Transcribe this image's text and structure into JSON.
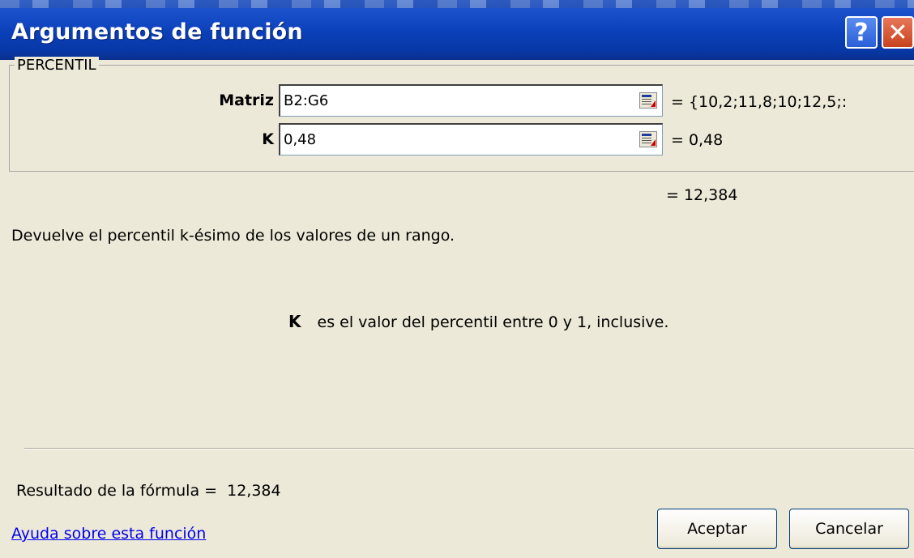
{
  "window": {
    "title": "Argumentos de función",
    "help_glyph": "?",
    "close_glyph": "✕"
  },
  "group": {
    "label": "PERCENTIL"
  },
  "arguments": [
    {
      "label": "Matriz",
      "value": "B2:G6",
      "evaluated": "=  {10,2;11,8;10;12,5;:"
    },
    {
      "label": "K",
      "value": "0,48",
      "evaluated": "=  0,48"
    }
  ],
  "result_preview": "= 12,384",
  "function_description": "Devuelve el percentil k-ésimo de los valores de un rango.",
  "argument_help": {
    "name": "K",
    "text": "es el valor del percentil entre 0 y 1, inclusive."
  },
  "formula_result": {
    "label": "Resultado de la fórmula =",
    "value": "12,384"
  },
  "help_link": "Ayuda sobre esta función",
  "buttons": {
    "ok": "Aceptar",
    "cancel": "Cancelar"
  },
  "colors": {
    "titlebar": "#0a3fb8",
    "dialog_bg": "#ece9d8",
    "link": "#0000ee"
  }
}
